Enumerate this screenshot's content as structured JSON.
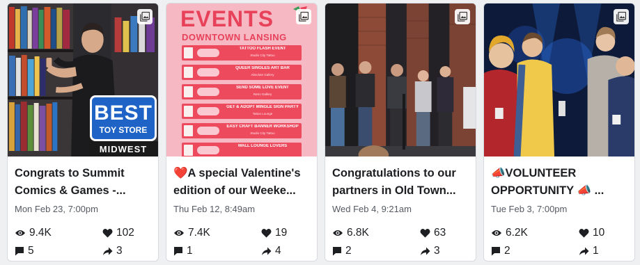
{
  "posts": [
    {
      "title": "Congrats to Summit Comics & Games -...",
      "date": "Mon Feb 23, 7:00pm",
      "views": "9.4K",
      "likes": "102",
      "comments": "5",
      "shares": "3",
      "image": {
        "badge_line1": "BEST",
        "badge_line2": "TOY STORE",
        "badge_line3": "MIDWEST"
      }
    },
    {
      "title": "❤️A special Valentine's edition of our Weeke...",
      "date": "Thu Feb 12, 8:49am",
      "views": "7.4K",
      "likes": "19",
      "comments": "1",
      "shares": "4",
      "image": {
        "heading": "EVENTS",
        "subheading": "DOWNTOWN LANSING",
        "events": [
          {
            "name": "TATTOO FLASH EVENT",
            "loc": "Studio City Tattoo"
          },
          {
            "name": "QUEER SINGLES ART BAR",
            "loc": "Absolute Gallery"
          },
          {
            "name": "SEND SOME LOVE EVENT",
            "loc": "Retro Gallery"
          },
          {
            "name": "GET & ADOPT MINGLE SIGN PARTY",
            "loc": "Tattoo Lounge"
          },
          {
            "name": "EASY CRAFT BANNER WORKSHOP",
            "loc": "Studio City Tattoo"
          },
          {
            "name": "WALL LOUNGE LOVERS",
            "loc": ""
          }
        ]
      }
    },
    {
      "title": "Congratulations to our partners in Old Town...",
      "date": "Wed Feb 4, 9:21am",
      "views": "6.8K",
      "likes": "63",
      "comments": "2",
      "shares": "3"
    },
    {
      "title": "📣VOLUNTEER OPPORTUNITY 📣 ...",
      "date": "Tue Feb 3, 7:00pm",
      "views": "6.2K",
      "likes": "10",
      "comments": "2",
      "shares": "1"
    }
  ],
  "icons": {
    "media": "photo-album-icon",
    "views": "eye-icon",
    "likes": "heart-icon",
    "comments": "comment-icon",
    "shares": "share-arrow-icon"
  },
  "colors": {
    "card_bg": "#ffffff",
    "page_bg": "#eef0f2",
    "events_pink": "#f6b8c3",
    "events_red": "#e7425a",
    "badge_blue": "#1e63c5"
  }
}
